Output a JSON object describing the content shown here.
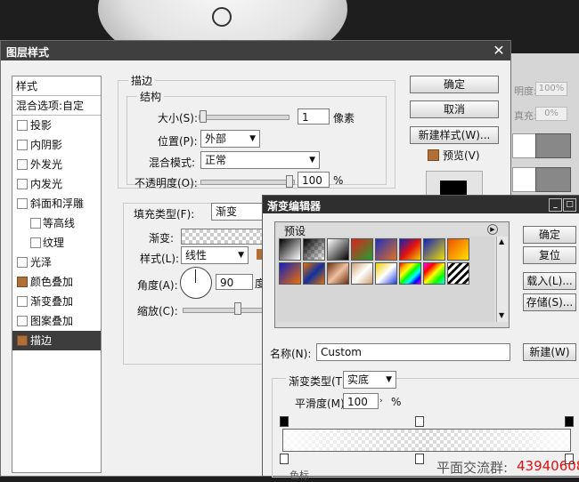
{
  "layer_style": {
    "title": "图层样式",
    "styles_header": "样式",
    "blend_options": "混合选项:自定",
    "items": [
      {
        "label": "投影",
        "checked": false
      },
      {
        "label": "内阴影",
        "checked": false
      },
      {
        "label": "外发光",
        "checked": false
      },
      {
        "label": "内发光",
        "checked": false
      },
      {
        "label": "斜面和浮雕",
        "checked": false
      },
      {
        "label": "等高线",
        "checked": false
      },
      {
        "label": "纹理",
        "checked": false
      },
      {
        "label": "光泽",
        "checked": false
      },
      {
        "label": "颜色叠加",
        "checked": true
      },
      {
        "label": "渐变叠加",
        "checked": false
      },
      {
        "label": "图案叠加",
        "checked": false
      },
      {
        "label": "描边",
        "checked": true
      }
    ],
    "stroke_group": "描边",
    "structure_group": "结构",
    "size_label": "大小(S):",
    "size_value": "1",
    "size_unit": "像素",
    "position_label": "位置(P):",
    "position_value": "外部",
    "blend_label": "混合模式:",
    "blend_value": "正常",
    "opacity_label": "不透明度(O):",
    "opacity_value": "100",
    "opacity_unit": "%",
    "fill_type_label": "填充类型(F):",
    "fill_type_value": "渐变",
    "gradient_label": "渐变:",
    "style_label": "样式(L):",
    "style_value": "线性",
    "angle_label": "角度(A):",
    "angle_value": "90",
    "angle_unit": "度",
    "scale_label": "缩放(C):",
    "ok": "确定",
    "cancel": "取消",
    "new_style": "新建样式(W)...",
    "preview": "预览(V)"
  },
  "layers_panel": {
    "opacity_label": "明度:",
    "opacity_value": "100%",
    "fill_label": "真充:",
    "fill_value": "0%"
  },
  "gradient_editor": {
    "title": "渐变编辑器",
    "presets_label": "预设",
    "ok": "确定",
    "reset": "复位",
    "load": "载入(L)...",
    "save": "存储(S)...",
    "name_label": "名称(N):",
    "name_value": "Custom",
    "new_button": "新建(W)",
    "type_label": "渐变类型(T):",
    "type_value": "实底",
    "smooth_label": "平滑度(M):",
    "smooth_value": "100",
    "smooth_unit": "%",
    "stops_label": "色标"
  },
  "watermark": {
    "text": "平面交流群:",
    "number": "43940608",
    "number_color": "#e01010"
  }
}
